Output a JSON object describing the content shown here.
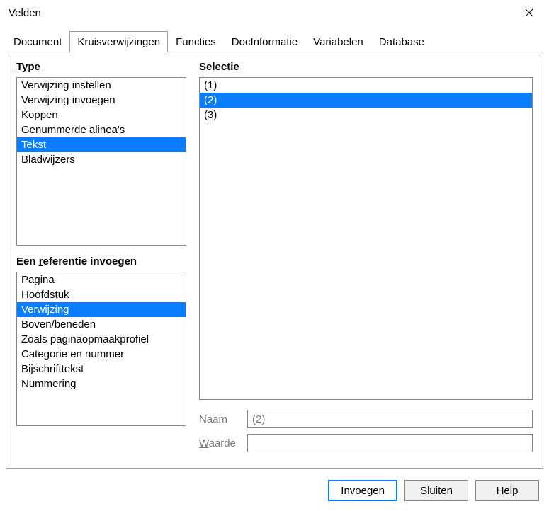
{
  "window": {
    "title": "Velden"
  },
  "tabs": [
    {
      "label": "Document",
      "active": false
    },
    {
      "label": "Kruisverwijzingen",
      "active": true
    },
    {
      "label": "Functies",
      "active": false
    },
    {
      "label": "DocInformatie",
      "active": false
    },
    {
      "label": "Variabelen",
      "active": false
    },
    {
      "label": "Database",
      "active": false
    }
  ],
  "labels": {
    "type_plain": "Type",
    "selection_pre": "S",
    "selection_u": "e",
    "selection_post": "lectie",
    "ref_pre": "Een ",
    "ref_u": "r",
    "ref_post": "eferentie invoegen",
    "name": "Naam",
    "value_u": "W",
    "value_post": "aarde"
  },
  "type_items": [
    {
      "label": "Verwijzing instellen",
      "selected": false
    },
    {
      "label": "Verwijzing invoegen",
      "selected": false
    },
    {
      "label": "Koppen",
      "selected": false
    },
    {
      "label": "Genummerde alinea's",
      "selected": false
    },
    {
      "label": "Tekst",
      "selected": true
    },
    {
      "label": "Bladwijzers",
      "selected": false
    }
  ],
  "ref_items": [
    {
      "label": "Pagina",
      "selected": false
    },
    {
      "label": "Hoofdstuk",
      "selected": false
    },
    {
      "label": "Verwijzing",
      "selected": true
    },
    {
      "label": "Boven/beneden",
      "selected": false
    },
    {
      "label": "Zoals paginaopmaakprofiel",
      "selected": false
    },
    {
      "label": "Categorie en nummer",
      "selected": false
    },
    {
      "label": "Bijschrifttekst",
      "selected": false
    },
    {
      "label": "Nummering",
      "selected": false
    }
  ],
  "selection_items": [
    {
      "label": "(1)",
      "selected": false
    },
    {
      "label": "(2)",
      "selected": true
    },
    {
      "label": "(3)",
      "selected": false
    }
  ],
  "fields": {
    "name_value": "(2)",
    "value_value": ""
  },
  "buttons": {
    "insert_u": "I",
    "insert_post": "nvoegen",
    "close_u": "S",
    "close_post": "luiten",
    "help_u": "H",
    "help_post": "elp"
  }
}
